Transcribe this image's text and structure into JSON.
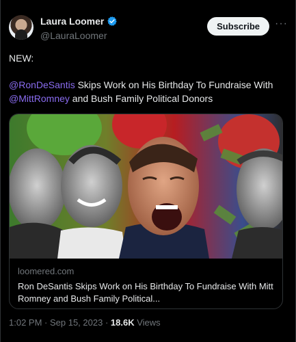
{
  "author": {
    "display_name": "Laura Loomer",
    "handle": "@LauraLoomer",
    "verified_icon": "verified-badge-icon"
  },
  "actions": {
    "subscribe_label": "Subscribe",
    "more_label": "···"
  },
  "tweet": {
    "line1": "NEW:",
    "mention1": "@RonDeSantis",
    "text_after_mention1": " Skips Work on His Birthday To Fundraise With ",
    "mention2": "@MittRomney",
    "text_after_mention2": " and Bush Family Political Donors"
  },
  "card": {
    "domain": "loomered.com",
    "title": "Ron DeSantis Skips Work on His Birthday To Fundraise With Mitt Romney and Bush Family Political..."
  },
  "meta": {
    "time": "1:02 PM",
    "separator": " · ",
    "date": "Sep 15, 2023",
    "views_count": "18.6K",
    "views_label": " Views"
  },
  "colors": {
    "background": "#000000",
    "mention": "#8a6cf0",
    "secondary_text": "#71767b",
    "verified": "#1d9bf0"
  }
}
